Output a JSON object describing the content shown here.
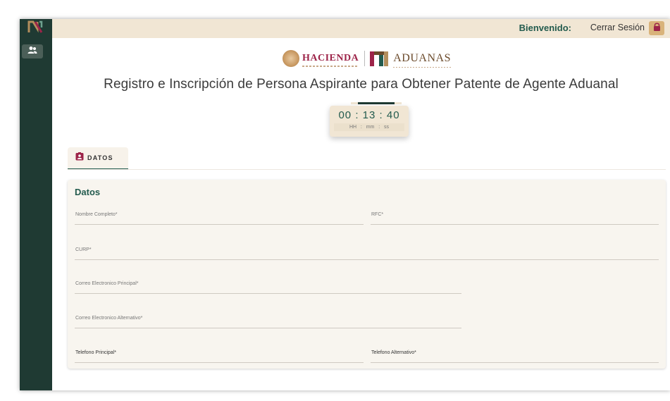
{
  "header": {
    "welcome_label": "Bienvenido:",
    "logout_label": "Cerrar Sesión"
  },
  "logos": {
    "hacienda": "HACIENDA",
    "aduanas": "ADUANAS"
  },
  "page": {
    "title": "Registro e Inscripción de Persona Aspirante para Obtener Patente de Agente Aduanal"
  },
  "timer": {
    "hours": "00",
    "minutes": "13",
    "seconds": "40",
    "unit_hours": "HH",
    "unit_minutes": "mm",
    "unit_seconds": "ss"
  },
  "tabs": [
    {
      "label": "DATOS"
    }
  ],
  "form": {
    "title": "Datos",
    "fields": {
      "nombre": "Nombre Completo*",
      "rfc": "RFC*",
      "curp": "CURP*",
      "correo_principal": "Correo Electronico Principal*",
      "correo_alternativo": "Correo Electronico Alternativo*",
      "telefono_principal": "Telefono Principal*",
      "telefono_alternativo": "Telefono Alternativo*"
    }
  },
  "colors": {
    "sidebar": "#1f3a33",
    "topbar": "#f1e6d4",
    "accent_green": "#235b4e",
    "accent_red": "#9d2449",
    "lock_button": "#d9b37a"
  },
  "icons": {
    "sidebar_logo": "gobierno-logo-icon",
    "sidebar_users": "users-icon",
    "lock": "lock-icon",
    "tab": "person-badge-icon"
  }
}
